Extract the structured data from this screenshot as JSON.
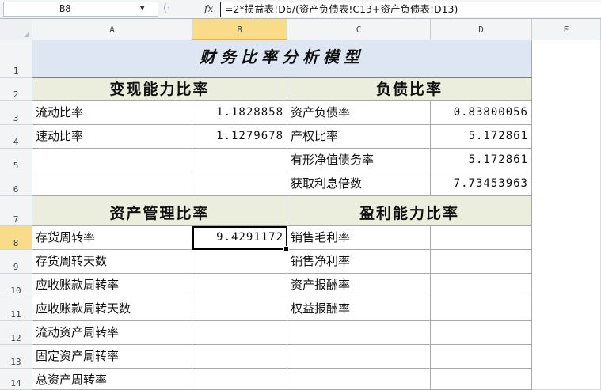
{
  "formula_bar": {
    "name_box": "B8",
    "fx_label": "fx",
    "formula": "=2*损益表!D6/(资产负债表!C13+资产负债表!D13)"
  },
  "columns": [
    "A",
    "B",
    "C",
    "D",
    "E"
  ],
  "rows": [
    "1",
    "2",
    "3",
    "4",
    "5",
    "6",
    "7",
    "8",
    "9",
    "10",
    "11",
    "12",
    "13",
    "14"
  ],
  "sheet": {
    "title": "财务比率分析模型",
    "sections": {
      "liquidity": "变现能力比率",
      "debt": "负债比率",
      "asset_mgmt": "资产管理比率",
      "profit": "盈利能力比率"
    },
    "liquidity_rows": [
      {
        "label": "流动比率",
        "value": "1.1828858"
      },
      {
        "label": "速动比率",
        "value": "1.1279678"
      }
    ],
    "debt_rows": [
      {
        "label": "资产负债率",
        "value": "0.83800056"
      },
      {
        "label": "产权比率",
        "value": "5.172861"
      },
      {
        "label": "有形净值债务率",
        "value": "5.172861"
      },
      {
        "label": "获取利息倍数",
        "value": "7.73453963"
      }
    ],
    "asset_rows": [
      {
        "label": "存货周转率",
        "value": "9.4291172"
      },
      {
        "label": "存货周转天数",
        "value": ""
      },
      {
        "label": "应收账款周转率",
        "value": ""
      },
      {
        "label": "应收账款周转天数",
        "value": ""
      },
      {
        "label": "流动资产周转率",
        "value": ""
      },
      {
        "label": "固定资产周转率",
        "value": ""
      },
      {
        "label": "总资产周转率",
        "value": ""
      }
    ],
    "profit_rows": [
      {
        "label": "销售毛利率",
        "value": ""
      },
      {
        "label": "销售净利率",
        "value": ""
      },
      {
        "label": "资产报酬率",
        "value": ""
      },
      {
        "label": "权益报酬率",
        "value": ""
      }
    ]
  }
}
